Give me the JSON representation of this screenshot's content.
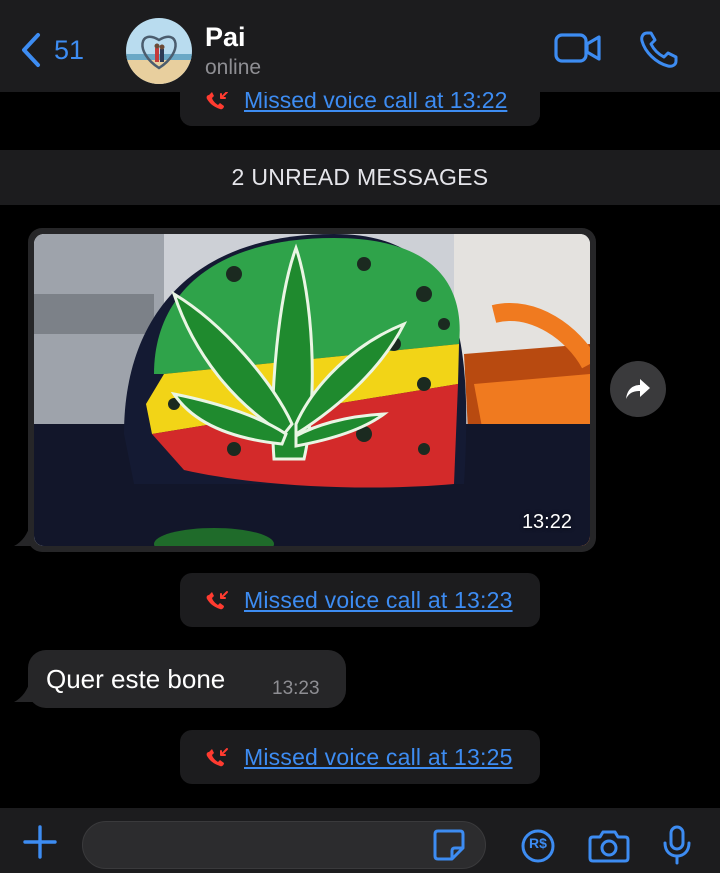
{
  "header": {
    "back_count": "51",
    "contact_name": "Pai",
    "contact_status": "online"
  },
  "messages": {
    "missed_call_1": "Missed voice call at 13:22",
    "unread_banner": "2 UNREAD MESSAGES",
    "image_time": "13:22",
    "missed_call_2": "Missed voice call at 13:23",
    "text_message": "Quer este bone",
    "text_time": "13:23",
    "missed_call_3": "Missed voice call at 13:25"
  },
  "composer": {
    "payment_label": "R$"
  },
  "colors": {
    "accent": "#3d8cf2",
    "missed_call_red": "#ff3b30",
    "bubble_incoming": "#262628",
    "bar_background": "#1c1c1e"
  },
  "icons": [
    "chevron-left-icon",
    "video-call-icon",
    "phone-icon",
    "missed-call-icon",
    "forward-icon",
    "plus-icon",
    "sticker-icon",
    "payment-icon",
    "camera-icon",
    "microphone-icon"
  ]
}
